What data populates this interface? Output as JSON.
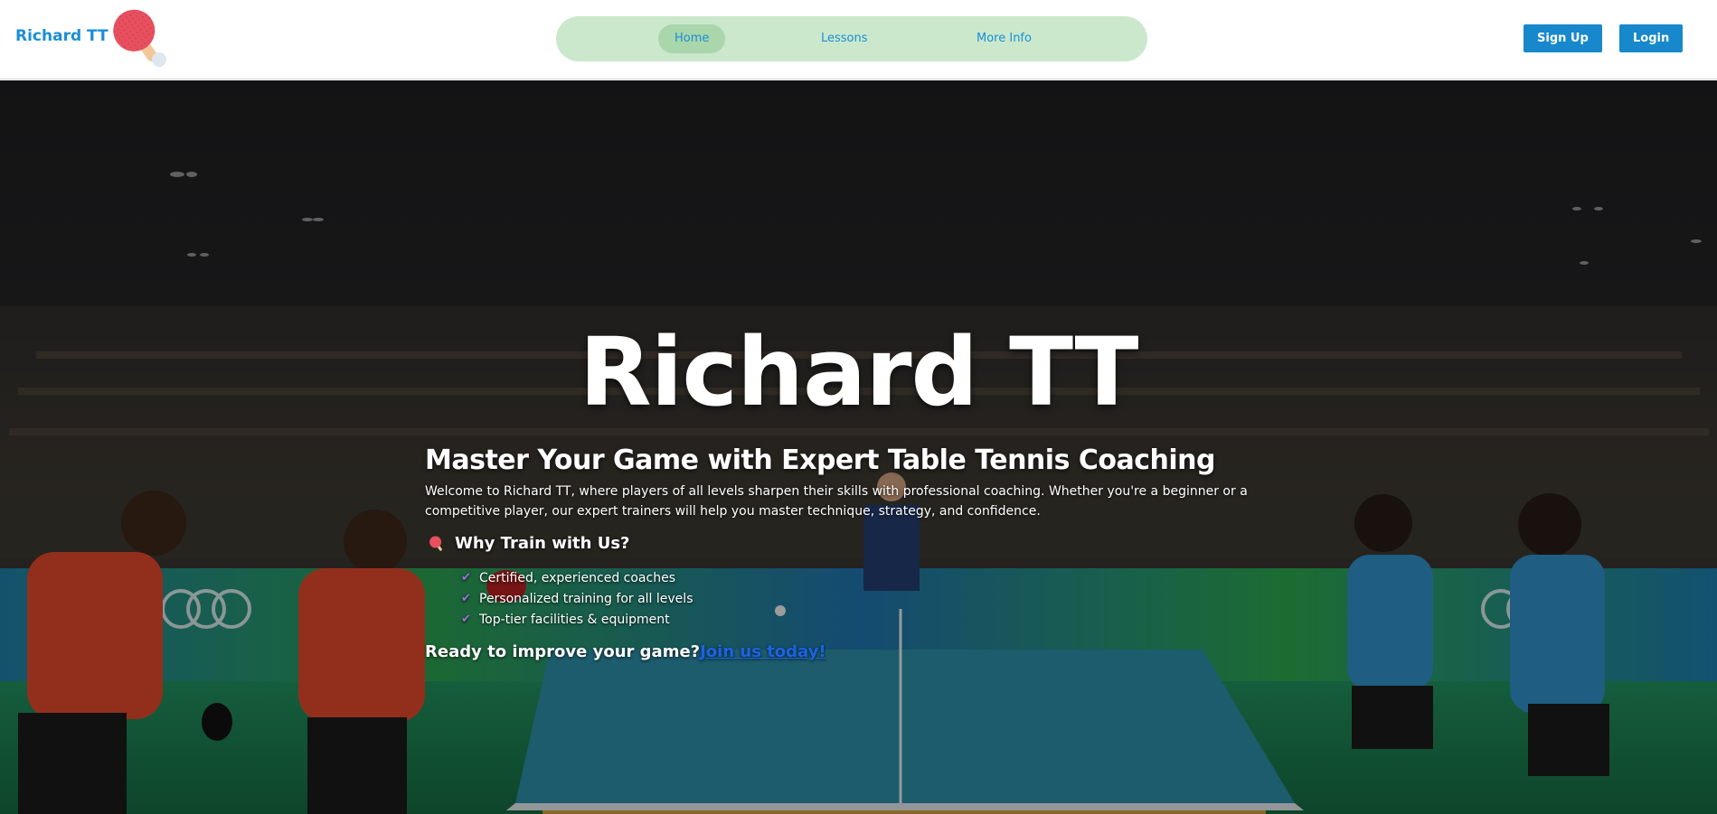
{
  "header": {
    "brand": "Richard TT",
    "logo_icon": "ping-pong-paddle-icon",
    "nav": [
      {
        "label": "Home",
        "active": true
      },
      {
        "label": "Lessons",
        "active": false
      },
      {
        "label": "More Info",
        "active": false
      }
    ],
    "signup_label": "Sign Up",
    "login_label": "Login"
  },
  "hero": {
    "title": "Richard TT",
    "subtitle": "Master Your Game with Expert Table Tennis Coaching",
    "intro": "Welcome to Richard TT, where players of all levels sharpen their skills with professional coaching. Whether you're a beginner or a competitive player, our expert trainers will help you master technique, strategy, and confidence.",
    "why_icon": "ping-pong-icon",
    "why_title": "Why Train with Us?",
    "check_icon": "checkmark-icon",
    "benefits": [
      "Certified, experienced coaches",
      "Personalized training for all levels",
      "Top-tier facilities & equipment"
    ],
    "cta_text": "Ready to improve your game?",
    "cta_link": "Join us today!"
  },
  "colors": {
    "brand": "#1a8fd6",
    "nav_bg": "#cbe8cc",
    "nav_active": "#a9d6ab",
    "button": "#1788cc",
    "link": "#1b62e8",
    "check": "#a070e0"
  }
}
